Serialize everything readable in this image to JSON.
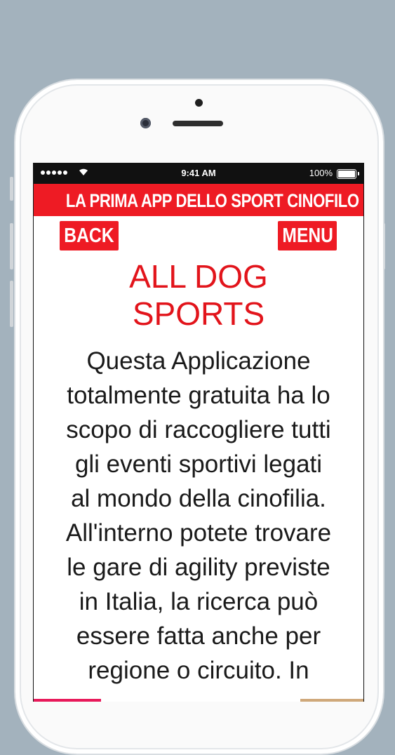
{
  "status_bar": {
    "time": "9:41 AM",
    "battery": "100%",
    "icons": [
      "signal-dots-icon",
      "wifi-icon",
      "battery-icon"
    ]
  },
  "app": {
    "header_title": "LA PRIMA APP DELLO SPORT CINOFILO",
    "back_label": "BACK",
    "menu_label": "MENU"
  },
  "content": {
    "title_lines": [
      "ALL DOG",
      "SPORTS"
    ],
    "body_lines": [
      "Questa Applicazione",
      "totalmente gratuita ha lo",
      "scopo di raccogliere tutti",
      "gli eventi sportivi legati",
      "al mondo della cinofilia.",
      "All'interno potete trovare",
      "le gare di agility previste",
      "in Italia, la ricerca può",
      "essere fatta anche per",
      "regione o circuito. In"
    ]
  },
  "colors": {
    "accent_red": "#ee1b24",
    "title_red": "#e2141b",
    "background": "#a3b2bd"
  }
}
